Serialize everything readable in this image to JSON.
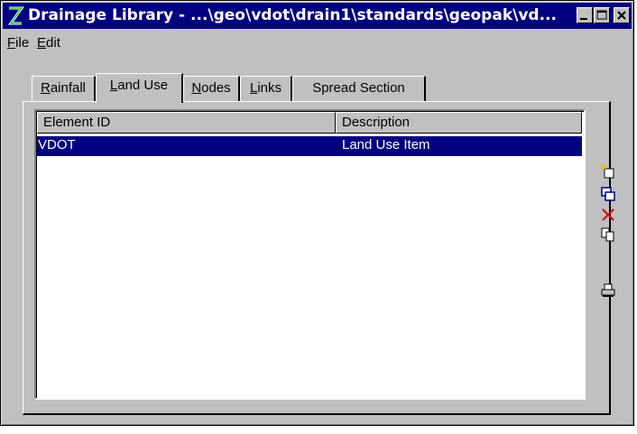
{
  "window": {
    "title": "Drainage Library - ...\\geo\\vdot\\drain1\\standards\\geopak\\vd..."
  },
  "menu": [
    {
      "label": "File",
      "mnemonic": "F",
      "rest": "ile"
    },
    {
      "label": "Edit",
      "mnemonic": "E",
      "rest": "dit"
    }
  ],
  "tabs": [
    {
      "label": "Rainfall",
      "mnemonic": "R",
      "rest": "ainfall"
    },
    {
      "label": "Land Use",
      "mnemonic": "L",
      "rest": "and Use",
      "active": true
    },
    {
      "label": "Nodes",
      "mnemonic": "N",
      "rest": "odes"
    },
    {
      "label": "Links",
      "mnemonic": "L",
      "rest": "inks"
    },
    {
      "label": "Spread Section",
      "mnemonic": "",
      "rest": "Spread Section"
    }
  ],
  "list": {
    "columns": [
      "Element ID",
      "Description"
    ],
    "rows": [
      {
        "element_id": "VDOT",
        "description": "Land Use Item",
        "selected": true
      }
    ]
  },
  "toolbar": [
    {
      "icon": "new-icon"
    },
    {
      "icon": "edit-icon"
    },
    {
      "icon": "delete-icon"
    },
    {
      "icon": "copy-icon"
    },
    {
      "icon": "print-icon"
    }
  ],
  "colors": {
    "titlebar": "#000080",
    "selection": "#000080",
    "face": "#c0c0c0",
    "delete": "#cc0000"
  }
}
